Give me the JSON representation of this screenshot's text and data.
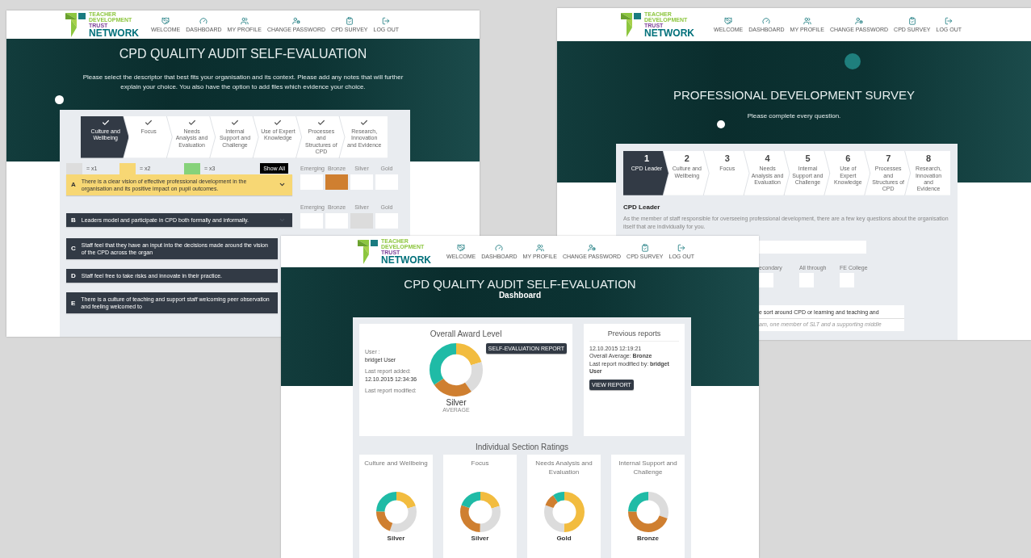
{
  "audit_window": {
    "logo": [
      "TEACHER",
      "DEVELOPMENT",
      "TRUST",
      "NETWORK"
    ],
    "nav": [
      "WELCOME",
      "DASHBOARD",
      "MY PROFILE",
      "CHANGE PASSWORD",
      "CPD SURVEY",
      "LOG OUT"
    ],
    "title": "CPD QUALITY AUDIT SELF-EVALUATION",
    "intro": "Please select the descriptor that best fits your organisation and its context. Please add any notes that will further explain your choice. You also have the option to add files which evidence your choice.",
    "steps": [
      {
        "label": "Culture and Wellbeing",
        "selected": true,
        "completed": true
      },
      {
        "label": "Focus",
        "selected": false,
        "completed": true
      },
      {
        "label": "Needs Analysis and Evaluation",
        "selected": false,
        "completed": true
      },
      {
        "label": "Internal Support and Challenge",
        "selected": false,
        "completed": true
      },
      {
        "label": "Use of Expert Knowledge",
        "selected": false,
        "completed": true
      },
      {
        "label": "Processes and Structures of CPD",
        "selected": false,
        "completed": true
      },
      {
        "label": "Research, Innovation and Evidence",
        "selected": false,
        "completed": true
      }
    ],
    "legend": [
      {
        "label": "= x1",
        "color": "#dddddd"
      },
      {
        "label": "= x2",
        "color": "#f7d774"
      },
      {
        "label": "= x3",
        "color": "#86d27a"
      }
    ],
    "show_all": "Show All",
    "descriptors": [
      {
        "letter": "A",
        "text": "There is a clear vision of effective professional development in the organisation and its positive impact on pupil outcomes.",
        "selected": true,
        "levels": [
          {
            "label": "Emerging",
            "selected": false
          },
          {
            "label": "Bronze",
            "selected": true
          },
          {
            "label": "Silver",
            "selected": false
          },
          {
            "label": "Gold",
            "selected": false
          }
        ]
      },
      {
        "letter": "B",
        "text": "Leaders model and participate in CPD both formally and informally.",
        "selected": false,
        "levels": [
          {
            "label": "Emerging",
            "selected": false
          },
          {
            "label": "Bronze",
            "selected": false
          },
          {
            "label": "Silver",
            "selected": true
          },
          {
            "label": "Gold",
            "selected": false
          }
        ]
      },
      {
        "letter": "C",
        "text": "Staff feel that they have an input into the decisions made around the vision of the CPD across the organ",
        "selected": false
      },
      {
        "letter": "D",
        "text": "Staff feel free to take risks and innovate in their practice.",
        "selected": false
      },
      {
        "letter": "E",
        "text": "There is a culture of teaching and support staff welcoming peer observation and feeling welcomed to",
        "selected": false
      }
    ]
  },
  "survey_window": {
    "logo": [
      "TEACHER",
      "DEVELOPMENT",
      "TRUST",
      "NETWORK"
    ],
    "nav": [
      "WELCOME",
      "DASHBOARD",
      "MY PROFILE",
      "CHANGE PASSWORD",
      "CPD SURVEY",
      "LOG OUT"
    ],
    "title": "PROFESSIONAL DEVELOPMENT SURVEY",
    "subtitle": "Please complete every question.",
    "steps": [
      {
        "number": "1",
        "label": "CPD Leader",
        "selected": true
      },
      {
        "number": "2",
        "label": "Culture and Wellbeing",
        "selected": false
      },
      {
        "number": "3",
        "label": "Focus",
        "selected": false
      },
      {
        "number": "4",
        "label": "Needs Analysis and Evaluation",
        "selected": false
      },
      {
        "number": "5",
        "label": "Internal Support and Challenge",
        "selected": false
      },
      {
        "number": "6",
        "label": "Use of Expert Knowledge",
        "selected": false
      },
      {
        "number": "7",
        "label": "Processes and Structures of CPD",
        "selected": false
      },
      {
        "number": "8",
        "label": "Research, Innovation and Evidence",
        "selected": false
      }
    ],
    "section_heading": "CPD Leader",
    "section_text": "As the member of staff responsible for overseeing professional development, there are a few key questions about the organisation itself that are individually for you.",
    "org_types": [
      {
        "label": "econdary",
        "checked": false
      },
      {
        "label": "All through",
        "checked": false
      },
      {
        "label": "FE College",
        "checked": false
      }
    ],
    "question": "e sort around CPD or learning and teaching and",
    "hint": "am, one member of SLT and a supporting middle"
  },
  "dashboard_window": {
    "logo": [
      "TEACHER",
      "DEVELOPMENT",
      "TRUST",
      "NETWORK"
    ],
    "nav": [
      "WELCOME",
      "DASHBOARD",
      "MY PROFILE",
      "CHANGE PASSWORD",
      "CPD SURVEY",
      "LOG OUT"
    ],
    "title": "CPD QUALITY AUDIT SELF-EVALUATION",
    "subtitle": "Dashboard",
    "award": {
      "heading": "Overall Award Level",
      "fields": [
        {
          "label": "User :",
          "value": "bridget User"
        },
        {
          "label": "Last report added:",
          "value": "12.10.2015 12:34:36"
        },
        {
          "label": "Last report modified:"
        }
      ],
      "level": "Silver",
      "caption": "AVERAGE",
      "button": "SELF-EVALUATION REPORT"
    },
    "previous": {
      "heading": "Previous reports",
      "date": "12.10.2015 12:19:21",
      "lines": [
        "Overall Average: **Bronze**",
        "Last report modified by: **bridget User**"
      ],
      "button": "VIEW REPORT"
    },
    "sections_heading": "Individual Section Ratings",
    "sections": [
      {
        "title": "Culture and Wellbeing",
        "rating": "Silver"
      },
      {
        "title": "Focus",
        "rating": "Silver"
      },
      {
        "title": "Needs Analysis and Evaluation",
        "rating": "Gold"
      },
      {
        "title": "Internal Support and Challenge",
        "rating": "Bronze"
      }
    ]
  }
}
